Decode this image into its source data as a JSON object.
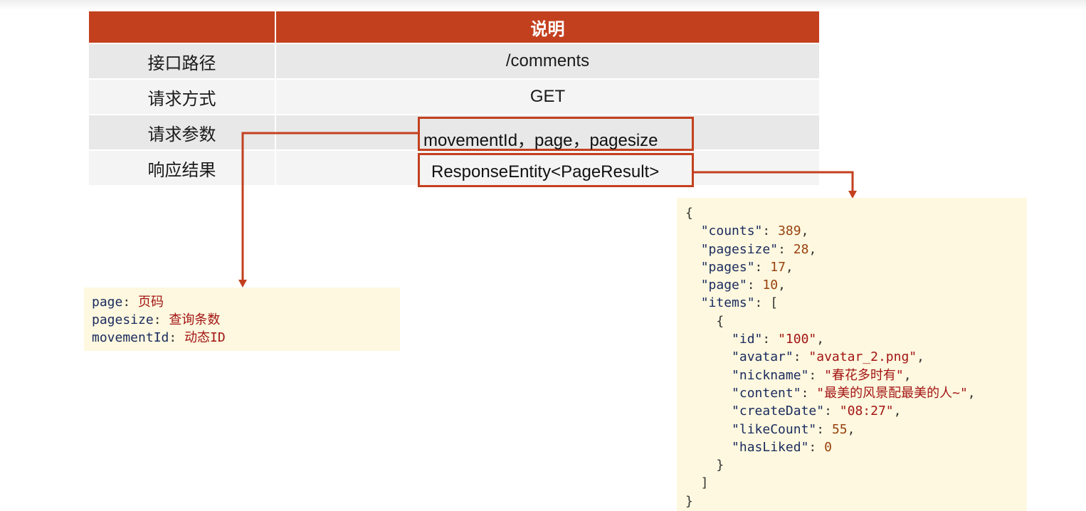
{
  "table": {
    "header": [
      "",
      "说明"
    ],
    "rows": [
      {
        "label": "接口路径",
        "value": "/comments"
      },
      {
        "label": "请求方式",
        "value": "GET"
      },
      {
        "label": "请求参数",
        "value": "movementId，page，pagesize"
      },
      {
        "label": "响应结果",
        "value": "ResponseEntity<PageResult>"
      }
    ]
  },
  "params_note": [
    {
      "key": "page",
      "desc": "页码"
    },
    {
      "key": "pagesize",
      "desc": "查询条数"
    },
    {
      "key": "movementId",
      "desc": "动态ID"
    }
  ],
  "response": {
    "counts": "389",
    "pagesize": "28",
    "pages": "17",
    "page": "10",
    "item": {
      "id": "\"100\"",
      "avatar": "\"avatar_2.png\"",
      "nickname": "\"春花多时有\"",
      "content": "\"最美的风景配最美的人~\"",
      "createDate": "\"08:27\"",
      "likeCount": "55",
      "hasLiked": "0"
    }
  },
  "colors": {
    "accent": "#c3401f",
    "note_bg": "#fdf8df",
    "row_dark": "#e8e8e8",
    "row_light": "#f4f4f4"
  }
}
